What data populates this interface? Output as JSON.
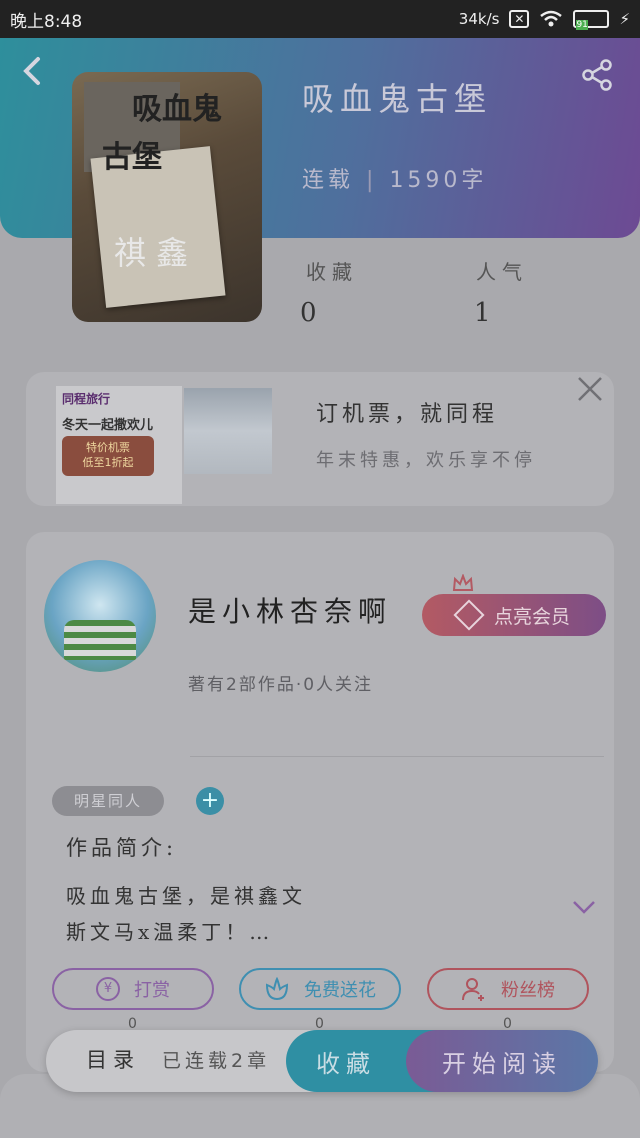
{
  "status_bar": {
    "time": "晚上8:48",
    "speed": "34k/s",
    "battery": "91"
  },
  "book": {
    "title": "吸血鬼古堡",
    "status": "连载",
    "word_count": "1590字",
    "cover_title_line1": "吸血鬼",
    "cover_title_line2": "古堡",
    "cover_names": "祺 鑫"
  },
  "stats": {
    "favorites_label": "收藏",
    "favorites_value": "0",
    "popularity_label": "人气",
    "popularity_value": "1"
  },
  "ad": {
    "brand": "同程旅行",
    "line1": "冬天一起撒欢儿",
    "box_line1": "特价机票",
    "box_line2": "低至1折起",
    "title": "订机票，就同程",
    "subtitle": "年末特惠，欢乐享不停"
  },
  "author": {
    "name": "是小林杏奈啊",
    "info": "著有2部作品·0人关注",
    "vip_label": "点亮会员"
  },
  "tag": "明星同人",
  "intro": {
    "label": "作品简介:",
    "text_line1": "吸血鬼古堡，是祺鑫文",
    "text_line2": "斯文马x温柔丁！…"
  },
  "actions": [
    {
      "label": "打赏",
      "count": "0",
      "icon": "yen-icon"
    },
    {
      "label": "免费送花",
      "count": "0",
      "icon": "flower-icon"
    },
    {
      "label": "粉丝榜",
      "count": "0",
      "icon": "fan-icon"
    }
  ],
  "bottom": {
    "toc": "目录",
    "serial": "已连载2章",
    "favorite": "收藏",
    "read": "开始阅读"
  },
  "colors": {
    "hero_start": "#2e8f9c",
    "hero_end": "#6d4a93",
    "vip_start": "#b35a63",
    "vip_end": "#7d4e86"
  }
}
